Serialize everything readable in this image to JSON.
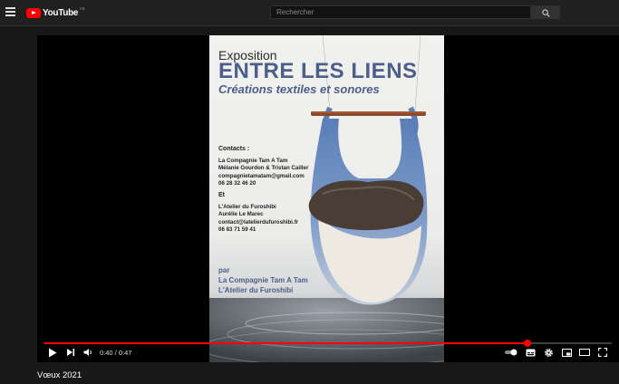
{
  "header": {
    "logo_text": "YouTube",
    "logo_region": "FR",
    "search_placeholder": "Rechercher"
  },
  "poster": {
    "title_small": "Exposition",
    "title_big": "ENTRE LES LIENS",
    "subtitle": "Créations textiles et sonores",
    "contacts_head": "Contacts :",
    "contact1": [
      "La Compagnie Tam A Tam",
      "Mélanie Gourdon & Tristan Cailler",
      "compagnietamatam@gmail.com",
      "06 28 32 46 20"
    ],
    "and": "Et",
    "contact2": [
      "L'Atelier du Furoshibi",
      "Aurélie Le Marec",
      "contact@latelierdufuroshibi.fr",
      "06 83 71 59 41"
    ],
    "par": "par",
    "par1": "La Compagnie Tam A Tam",
    "par2": "L'Atelier du Furoshibi"
  },
  "player": {
    "current_time": "0:40",
    "duration": "0:47",
    "time_display": "0:40 / 0:47",
    "progress_fraction": 0.851
  },
  "video": {
    "title": "Vœux 2021"
  },
  "colors": {
    "brand_red": "#ff0000",
    "poster_blue": "#4c5f8a",
    "background": "#181818"
  }
}
